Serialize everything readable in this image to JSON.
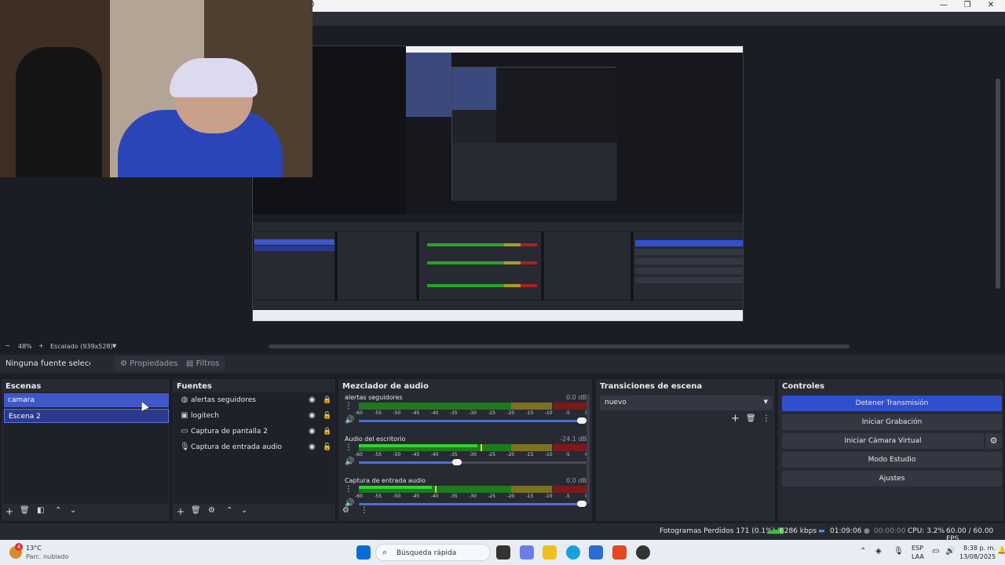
{
  "window": {
    "title_fragment": ")",
    "minimize": "—",
    "maximize": "❐",
    "close": "✕"
  },
  "preview_toolbar": {
    "minus": "−",
    "zoom": "48%",
    "plus": "+",
    "scale": "Escalado (939x528)",
    "dropdown": "▼"
  },
  "source_bar": {
    "status": "Ninguna fuente seleccionada",
    "properties": "Propiedades",
    "filters": "Filtros"
  },
  "docks": {
    "scenes": {
      "title": "Escenas",
      "items": [
        "camara",
        "Escena 2"
      ]
    },
    "sources": {
      "title": "Fuentes",
      "items": [
        {
          "label": "alertas seguidores",
          "icon": "globe-icon"
        },
        {
          "label": "logitech",
          "icon": "camera-icon"
        },
        {
          "label": "Captura de pantalla 2",
          "icon": "monitor-icon"
        },
        {
          "label": "Captura de entrada audio",
          "icon": "microphone-icon"
        }
      ]
    },
    "mixer": {
      "title": "Mezclador de audio",
      "channels": [
        {
          "name": "alertas seguidores",
          "db": "0.0 dB",
          "level": 0.0,
          "volume": 1.0
        },
        {
          "name": "Audio del escritorio",
          "db": "-24.1 dB",
          "level": 0.52,
          "volume": 0.45
        },
        {
          "name": "Captura de entrada audio",
          "db": "0.0 dB",
          "level": 0.32,
          "volume": 1.0
        }
      ],
      "ticks": [
        "-60",
        "-55",
        "-50",
        "-45",
        "-40",
        "-35",
        "-30",
        "-25",
        "-20",
        "-15",
        "-10",
        "-5",
        "0"
      ]
    },
    "transitions": {
      "title": "Transiciones de escena",
      "selected": "nuevo"
    },
    "controls": {
      "title": "Controles",
      "stop_stream": "Detener Transmisión",
      "start_recording": "Iniciar Grabación",
      "start_virtual_cam": "Iniciar Cámara Virtual",
      "studio_mode": "Modo Estudio",
      "settings": "Ajustes"
    }
  },
  "status": {
    "dropped_frames": "Fotogramas Perdidos 171 (0.1%)",
    "bitrate": "6286 kbps",
    "stream_time": "01:09:06",
    "rec_time": "00:00:00",
    "cpu": "CPU: 3.2%",
    "fps": "60.00 / 60.00 FPS"
  },
  "taskbar": {
    "weather_temp": "13°C",
    "weather_desc": "Parc. nublado",
    "weather_badge": "4",
    "search_placeholder": "Búsqueda rápida",
    "lang": "ESP",
    "lang_sub": "LAA",
    "time": "8:38 p. m.",
    "date": "13/08/2025"
  },
  "colors": {
    "accent": "#2f4fd0",
    "scene_selected": "#3f57c8",
    "meter_green": "#27a327",
    "meter_yellow": "#a89b27",
    "meter_red": "#a72222"
  }
}
